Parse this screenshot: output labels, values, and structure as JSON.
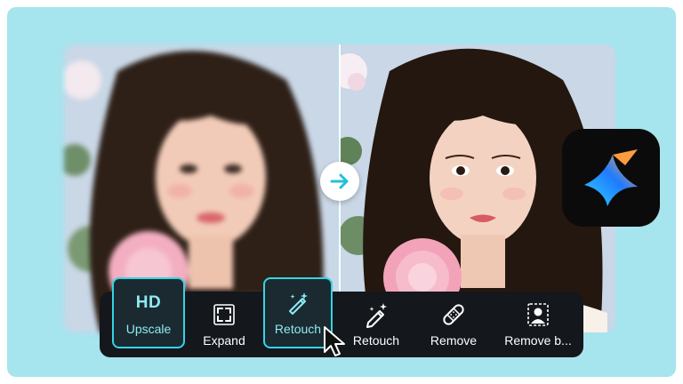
{
  "comparison": {
    "before_label": "",
    "after_label": ""
  },
  "colors": {
    "background": "#a6e4ee",
    "toolbar": "#14171c",
    "accent": "#35d4e4",
    "accent_text": "#8feaf3"
  },
  "toolbar": {
    "tools": [
      {
        "id": "upscale",
        "label": "Upscale",
        "badge": "HD",
        "icon": "hd-icon",
        "active": true
      },
      {
        "id": "expand",
        "label": "Expand",
        "icon": "expand-icon",
        "active": false
      },
      {
        "id": "retouch-ai",
        "label": "Retouch",
        "icon": "magic-wand-icon",
        "active": true
      },
      {
        "id": "retouch",
        "label": "Retouch",
        "icon": "pencil-sparkle-icon",
        "active": false
      },
      {
        "id": "remove",
        "label": "Remove",
        "icon": "bandage-icon",
        "active": false
      },
      {
        "id": "remove-bg",
        "label": "Remove b...",
        "icon": "portrait-dashed-icon",
        "active": false
      }
    ]
  },
  "app_logo": {
    "icon": "star-sparkle-logo-icon"
  }
}
